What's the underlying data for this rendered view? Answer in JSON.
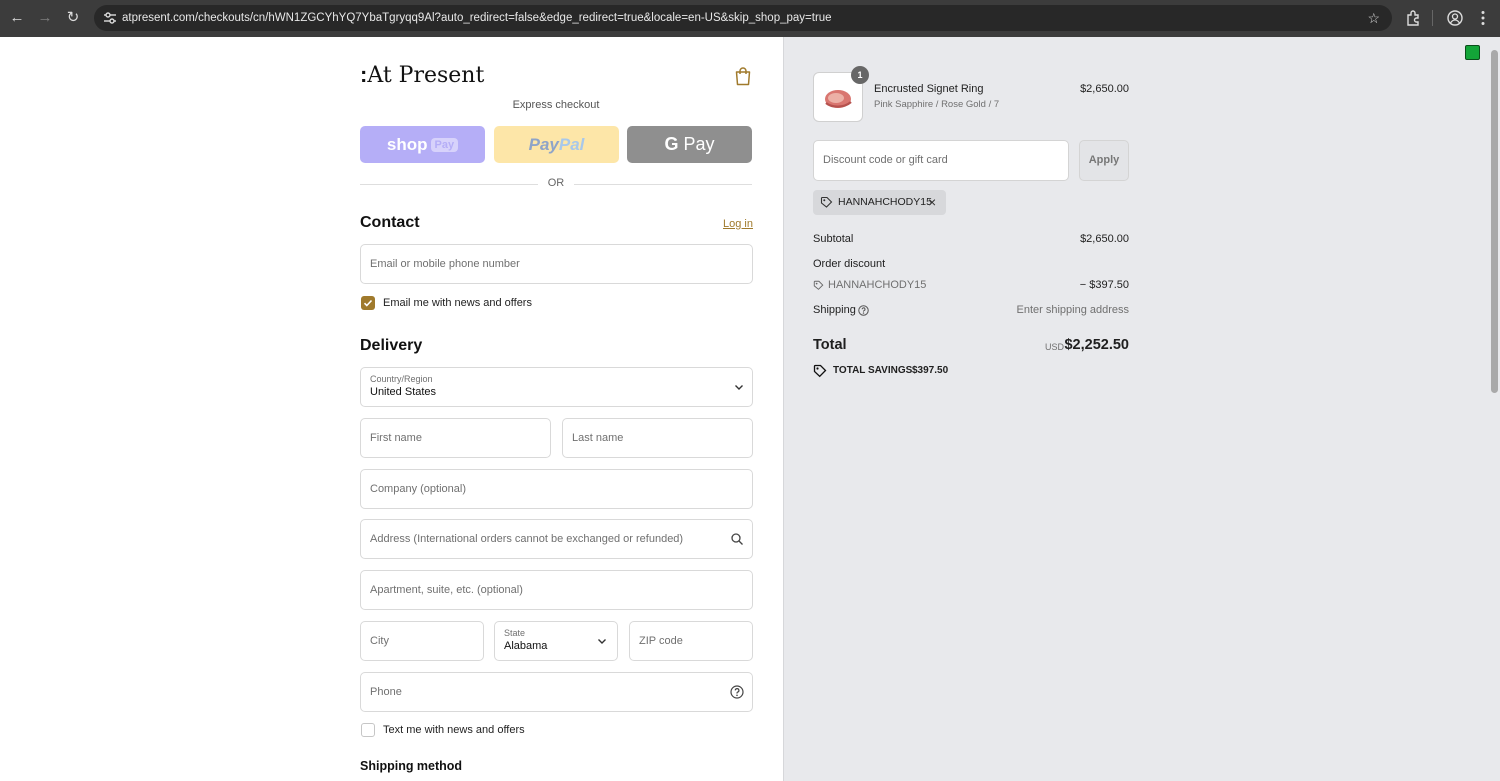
{
  "browser": {
    "url": "atpresent.com/checkouts/cn/hWN1ZGCYhYQ7YbaTgryqq9Al?auto_redirect=false&edge_redirect=true&locale=en-US&skip_shop_pay=true"
  },
  "brand": {
    "logo_colon": ":",
    "logo_text": "At Present"
  },
  "express": {
    "label": "Express checkout",
    "shop_pay": "shop",
    "shop_pay_pill": "Pay",
    "paypal_a": "Pay",
    "paypal_b": "Pal",
    "gpay_g": "G",
    "gpay_text": "Pay",
    "or": "OR"
  },
  "contact": {
    "title": "Contact",
    "login": "Log in",
    "email_placeholder": "Email or mobile phone number",
    "news_label": "Email me with news and offers"
  },
  "delivery": {
    "title": "Delivery",
    "country_label": "Country/Region",
    "country_value": "United States",
    "first_name": "First name",
    "last_name": "Last name",
    "company": "Company (optional)",
    "address": "Address (International orders cannot be exchanged or refunded)",
    "apartment": "Apartment, suite, etc. (optional)",
    "city": "City",
    "state_label": "State",
    "state_value": "Alabama",
    "zip": "ZIP code",
    "phone": "Phone",
    "sms_label": "Text me with news and offers"
  },
  "shipping": {
    "title": "Shipping method"
  },
  "summary": {
    "quantity": "1",
    "item_name": "Encrusted Signet Ring",
    "item_variant": "Pink Sapphire / Rose Gold / 7",
    "item_price": "$2,650.00",
    "discount_placeholder": "Discount code or gift card",
    "apply": "Apply",
    "applied_code": "HANNAHCHODY15",
    "subtotal_label": "Subtotal",
    "subtotal_value": "$2,650.00",
    "order_discount_label": "Order discount",
    "discount_code": "HANNAHCHODY15",
    "discount_value": "− $397.50",
    "shipping_label": "Shipping",
    "shipping_value": "Enter shipping address",
    "total_label": "Total",
    "currency": "USD",
    "total_value": "$2,252.50",
    "savings_label": "TOTAL SAVINGS",
    "savings_value": "$397.50"
  },
  "colors": {
    "accent": "#a07a2c",
    "shop_pay": "#b5aef7",
    "paypal": "#fde6a8",
    "gpay": "#8f8f8f",
    "summary_bg": "#e8e9ec"
  }
}
